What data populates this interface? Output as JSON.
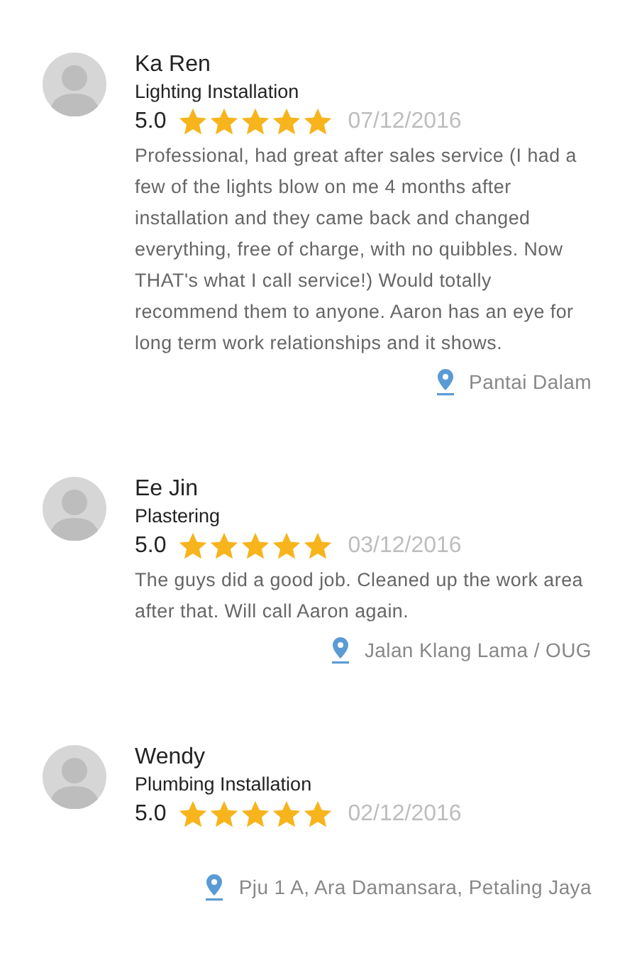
{
  "reviews": [
    {
      "name": "Ka Ren",
      "category": "Lighting Installation",
      "score": "5.0",
      "stars": 5,
      "date": "07/12/2016",
      "comment": "Professional, had great after sales service (I had a few of the lights blow on me 4 months after installation and they came back and changed everything, free of charge, with no quibbles. Now THAT's what I call service!) Would totally recommend them to anyone. Aaron has an eye for long term work relationships and it shows.",
      "location": "Pantai Dalam"
    },
    {
      "name": "Ee Jin",
      "category": "Plastering",
      "score": "5.0",
      "stars": 5,
      "date": "03/12/2016",
      "comment": "The guys did a good job. Cleaned up the work area after that. Will call Aaron again.",
      "location": "Jalan Klang Lama / OUG"
    },
    {
      "name": "Wendy",
      "category": "Plumbing Installation",
      "score": "5.0",
      "stars": 5,
      "date": "02/12/2016",
      "location": "Pju 1 A, Ara Damansara, Petaling Jaya"
    }
  ]
}
